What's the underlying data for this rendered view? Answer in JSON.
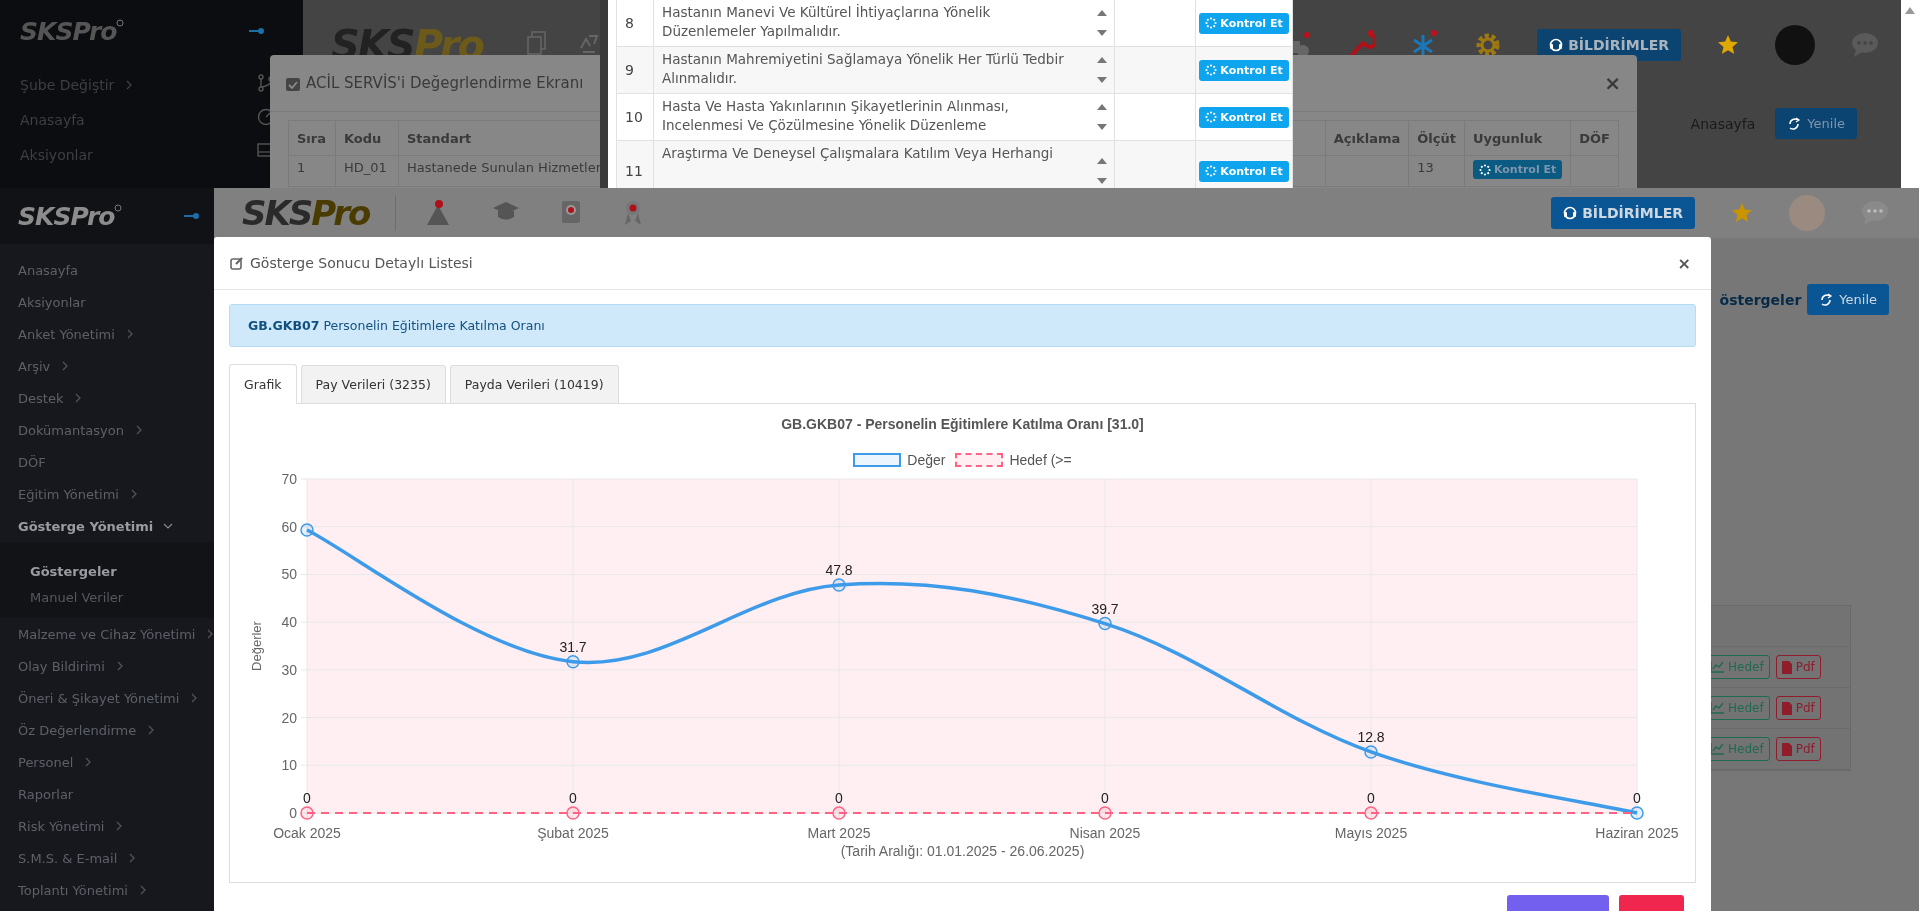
{
  "back_screen": {
    "sidebar": {
      "logo": "SKSPro",
      "items": [
        {
          "label": "Şube Değiştir",
          "has_children": true
        },
        {
          "label": "Anasayfa",
          "has_children": false
        },
        {
          "label": "Aksiyonlar",
          "has_children": false
        }
      ]
    },
    "header": {
      "logo_main": "SKS",
      "logo_accent": "Pro",
      "notifications_button": "BİLDİRİMLER"
    },
    "breadcrumb": "Anasayfa",
    "refresh_button": "Yenile",
    "modal": {
      "title": "ACİL SERVİS'i Değegrlendirme Ekranı",
      "close_icon": "×",
      "columns": [
        "Sıra",
        "Kodu",
        "Standart",
        "Açıklama",
        "Ölçüt",
        "Uygunluk",
        "DÖF"
      ],
      "rows": [
        {
          "no": "1",
          "code": "HD_01",
          "standard": "Hastanede Sunulan Hizmetler",
          "criterion": "13",
          "action": "Kontrol Et"
        }
      ]
    },
    "standards_panel": {
      "rows": [
        {
          "no": "8",
          "text": "Hastanın Manevi Ve Kültürel İhtiyaçlarına Yönelik Düzenlemeler Yapılmalıdır.",
          "action": "Kontrol Et"
        },
        {
          "no": "9",
          "text": "Hastanın Mahremiyetini Sağlamaya Yönelik Her Türlü Tedbir Alınmalıdır.",
          "action": "Kontrol Et"
        },
        {
          "no": "10",
          "text": "Hasta Ve Hasta Yakınlarının Şikayetlerinin Alınması, Incelenmesi Ve Çözülmesine Yönelik Düzenleme",
          "action": "Kontrol Et"
        },
        {
          "no": "11",
          "text": "Araştırma Ve Deneysel Çalışmalara Katılım Veya Herhangi",
          "action": "Kontrol Et"
        }
      ]
    }
  },
  "front_screen": {
    "sidebar": {
      "logo": "SKSPro",
      "items": [
        {
          "label": "Anasayfa",
          "has_children": false,
          "expanded": false
        },
        {
          "label": "Aksiyonlar",
          "has_children": false,
          "expanded": false
        },
        {
          "label": "Anket Yönetimi",
          "has_children": true,
          "expanded": false
        },
        {
          "label": "Arşiv",
          "has_children": true,
          "expanded": false
        },
        {
          "label": "Destek",
          "has_children": true,
          "expanded": false
        },
        {
          "label": "Dokümantasyon",
          "has_children": true,
          "expanded": false
        },
        {
          "label": "DÖF",
          "has_children": false,
          "expanded": false
        },
        {
          "label": "Eğitim Yönetimi",
          "has_children": true,
          "expanded": false
        },
        {
          "label": "Gösterge Yönetimi",
          "has_children": true,
          "expanded": true,
          "children": [
            {
              "label": "Göstergeler",
              "selected": true
            },
            {
              "label": "Manuel Veriler",
              "selected": false
            }
          ]
        },
        {
          "label": "Malzeme ve Cihaz Yönetimi",
          "has_children": true,
          "expanded": false
        },
        {
          "label": "Olay Bildirimi",
          "has_children": true,
          "expanded": false
        },
        {
          "label": "Öneri & Şikayet Yönetimi",
          "has_children": true,
          "expanded": false
        },
        {
          "label": "Öz Değerlendirme",
          "has_children": true,
          "expanded": false
        },
        {
          "label": "Personel",
          "has_children": true,
          "expanded": false
        },
        {
          "label": "Raporlar",
          "has_children": false,
          "expanded": false
        },
        {
          "label": "Risk Yönetimi",
          "has_children": true,
          "expanded": false
        },
        {
          "label": "S.M.S. & E-mail",
          "has_children": true,
          "expanded": false
        },
        {
          "label": "Toplantı Yönetimi",
          "has_children": true,
          "expanded": false
        }
      ]
    },
    "header": {
      "logo_main": "SKS",
      "logo_accent": "Pro",
      "notifications_button": "BİLDİRİMLER"
    },
    "page_link": "östergeler",
    "refresh_button": "Yenile",
    "background_table": {
      "rows": [
        {
          "target_button": "Hedef",
          "pdf_button": "Pdf"
        },
        {
          "target_button": "Hedef",
          "pdf_button": "Pdf"
        },
        {
          "target_button": "Hedef",
          "pdf_button": "Pdf"
        }
      ]
    },
    "modal": {
      "title": "Gösterge Sonucu Detaylı Listesi",
      "close_icon": "×",
      "indicator_code": "GB.GKB07",
      "indicator_name": "Personelin Eğitimlere Katılma Oranı",
      "tabs": [
        {
          "label": "Grafik",
          "selected": true
        },
        {
          "label": "Pay Verileri (3235)",
          "selected": false
        },
        {
          "label": "Payda Verileri (10419)",
          "selected": false
        }
      ],
      "chart_data": {
        "type": "line",
        "title": "GB.GKB07 - Personelin Eğitimlere Katılma Oranı [31.0]",
        "xlabel": "(Tarih Aralığı: 01.01.2025 - 26.06.2025)",
        "ylabel": "Değerler",
        "categories": [
          "Ocak 2025",
          "Şubat 2025",
          "Mart 2025",
          "Nisan 2025",
          "Mayıs 2025",
          "Haziran 2025"
        ],
        "series": [
          {
            "name": "Değer",
            "color": "#3d9be9",
            "marker": "circle",
            "line_style": "solid",
            "values": [
              59.3,
              31.7,
              47.8,
              39.7,
              12.8,
              0
            ]
          },
          {
            "name": "Hedef (>=",
            "color": "#ff6384",
            "marker": "circle",
            "line_style": "dashed",
            "values": [
              0,
              0,
              0,
              0,
              0,
              0
            ]
          }
        ],
        "grid": true,
        "legend": true,
        "ylim": [
          0,
          70
        ],
        "yticks": [
          0,
          10,
          20,
          30,
          40,
          50,
          60,
          70
        ],
        "value_labels": [
          [
            null,
            "31.7",
            "47.8",
            "39.7",
            "12.8",
            "0"
          ],
          [
            "0",
            "0",
            "0",
            "0",
            "0",
            null
          ]
        ]
      },
      "footer_buttons": [
        {
          "kind": "primary"
        },
        {
          "kind": "danger"
        }
      ]
    }
  }
}
